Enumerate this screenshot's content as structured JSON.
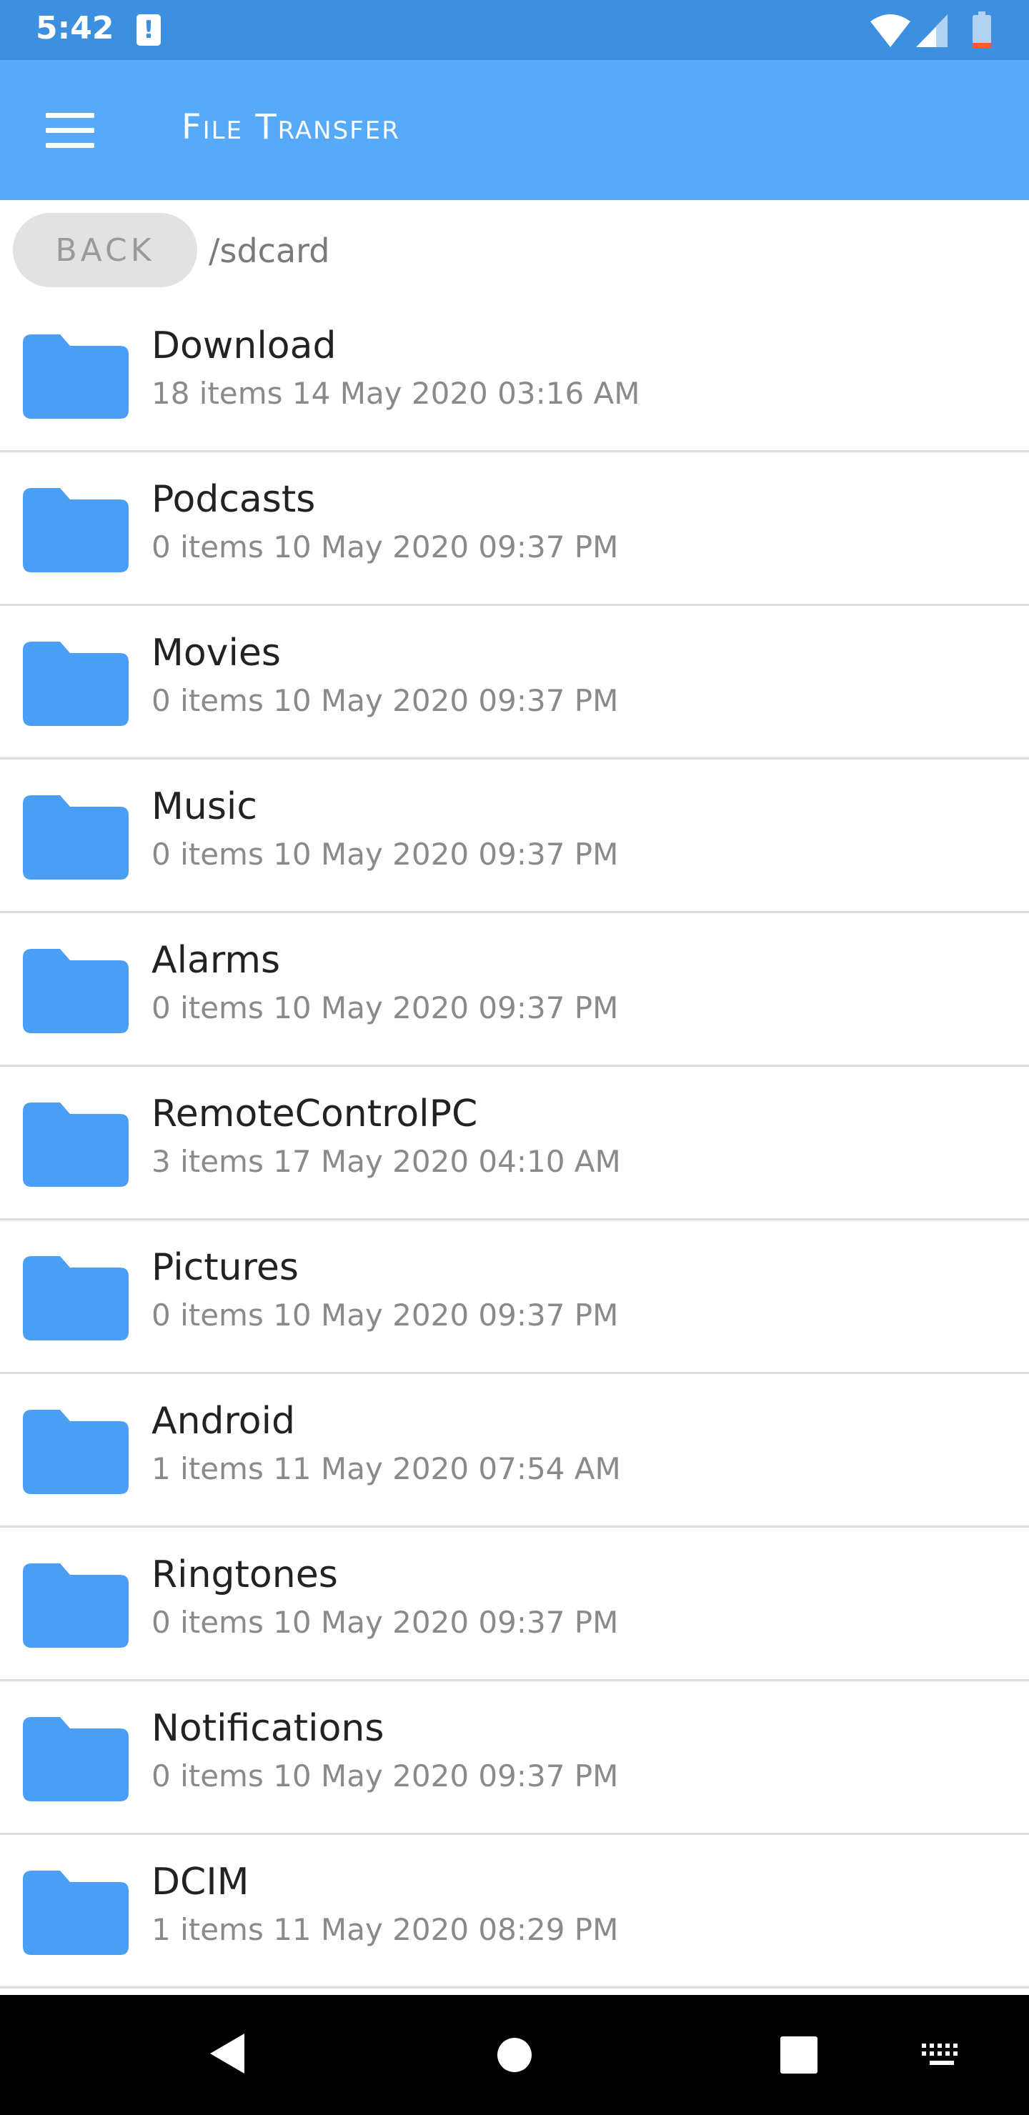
{
  "status_bar": {
    "time": "5:42",
    "alert_glyph": "!",
    "icons": [
      "alert-icon",
      "wifi-icon",
      "signal-icon",
      "battery-icon"
    ]
  },
  "app_bar": {
    "title": "File Transfer",
    "menu_icon": "menu-icon",
    "background_color": "#56aaf9"
  },
  "path_bar": {
    "back_label": "BACK",
    "current_path": "/sdcard"
  },
  "folders": [
    {
      "name": "Download",
      "meta": "18 items 14 May 2020 03:16 AM"
    },
    {
      "name": "Podcasts",
      "meta": "0 items 10 May 2020 09:37 PM"
    },
    {
      "name": "Movies",
      "meta": "0 items 10 May 2020 09:37 PM"
    },
    {
      "name": "Music",
      "meta": "0 items 10 May 2020 09:37 PM"
    },
    {
      "name": "Alarms",
      "meta": "0 items 10 May 2020 09:37 PM"
    },
    {
      "name": "RemoteControlPC",
      "meta": "3 items 17 May 2020 04:10 AM"
    },
    {
      "name": "Pictures",
      "meta": "0 items 10 May 2020 09:37 PM"
    },
    {
      "name": "Android",
      "meta": "1 items 11 May 2020 07:54 AM"
    },
    {
      "name": "Ringtones",
      "meta": "0 items 10 May 2020 09:37 PM"
    },
    {
      "name": "Notifications",
      "meta": "0 items 10 May 2020 09:37 PM"
    },
    {
      "name": "DCIM",
      "meta": "1 items 11 May 2020 08:29 PM"
    }
  ],
  "nav_bar": {
    "buttons": [
      "back-icon",
      "home-icon",
      "recents-icon",
      "keyboard-icon"
    ]
  },
  "colors": {
    "status_bar": "#3d8fe0",
    "accent": "#56aaf9",
    "folder": "#4a9ff5"
  }
}
